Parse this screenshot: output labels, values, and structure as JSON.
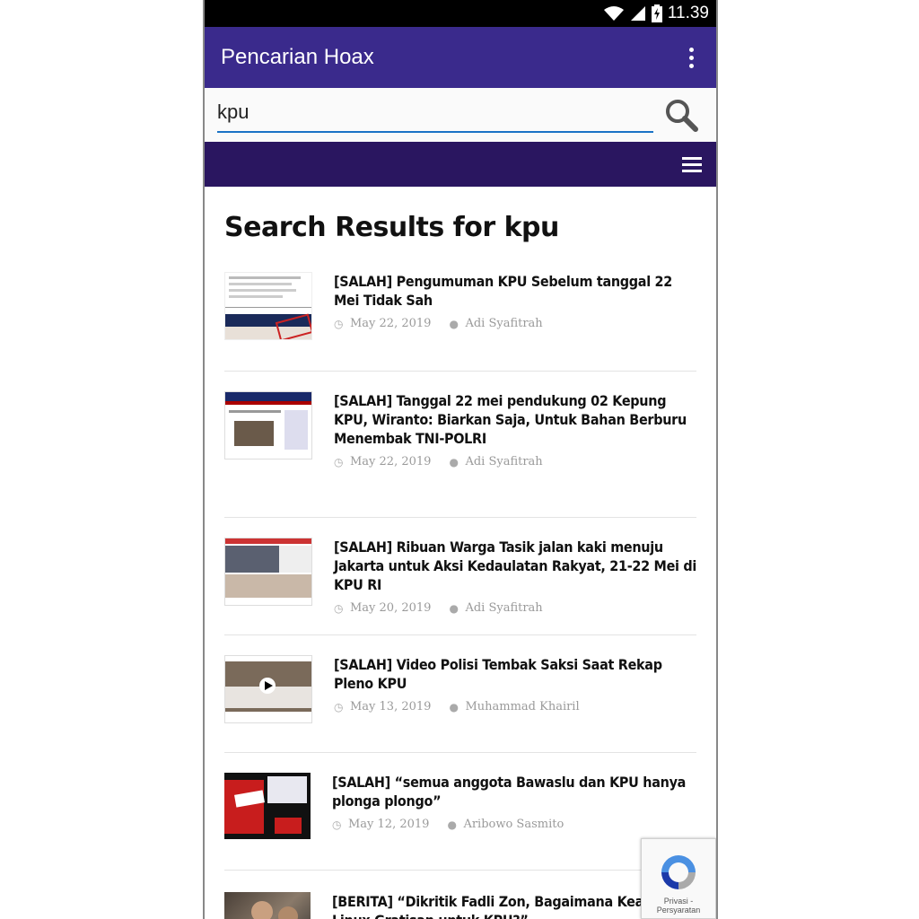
{
  "status_bar": {
    "time": "11.39",
    "icons": [
      "wifi-icon",
      "signal-icon",
      "battery-icon"
    ]
  },
  "app_bar": {
    "title": "Pencarian Hoax",
    "menu_icon": "more-vert-icon"
  },
  "search": {
    "value": "kpu",
    "button_icon": "search-icon"
  },
  "nav": {
    "menu_icon": "hamburger-menu-icon"
  },
  "page": {
    "title": "Search Results for kpu"
  },
  "articles": [
    {
      "title": "[SALAH] Pengumuman KPU Sebelum tanggal 22 Mei Tidak Sah",
      "date": "May 22, 2019",
      "author": "Adi Syafitrah"
    },
    {
      "title": "[SALAH] Tanggal 22 mei pendukung 02 Kepung KPU, Wiranto: Biarkan Saja, Untuk Bahan Berburu Menembak TNI-POLRI",
      "date": "May 22, 2019",
      "author": "Adi Syafitrah"
    },
    {
      "title": "[SALAH] Ribuan Warga Tasik jalan kaki menuju Jakarta untuk Aksi Kedaulatan Rakyat, 21-22 Mei di KPU RI",
      "date": "May 20, 2019",
      "author": "Adi Syafitrah"
    },
    {
      "title": "[SALAH] Video Polisi Tembak Saksi Saat Rekap Pleno KPU",
      "date": "May 13, 2019",
      "author": "Muhammad Khairil"
    },
    {
      "title": "[SALAH] “semua anggota Bawaslu dan KPU hanya plonga plongo”",
      "date": "May 12, 2019",
      "author": "Aribowo Sasmito"
    },
    {
      "title": "[BERITA] “Dikritik Fadli Zon, Bagaimana Keamanan Linux Gratisan untuk KPU?”",
      "date": "",
      "author": ""
    }
  ],
  "recaptcha": {
    "label": "Privasi - Persyaratan"
  },
  "colors": {
    "app_bar": "#3a2a8c",
    "nav_bar": "#2a1660",
    "input_underline": "#1a73c6",
    "meta_text": "#9a9a9a"
  }
}
